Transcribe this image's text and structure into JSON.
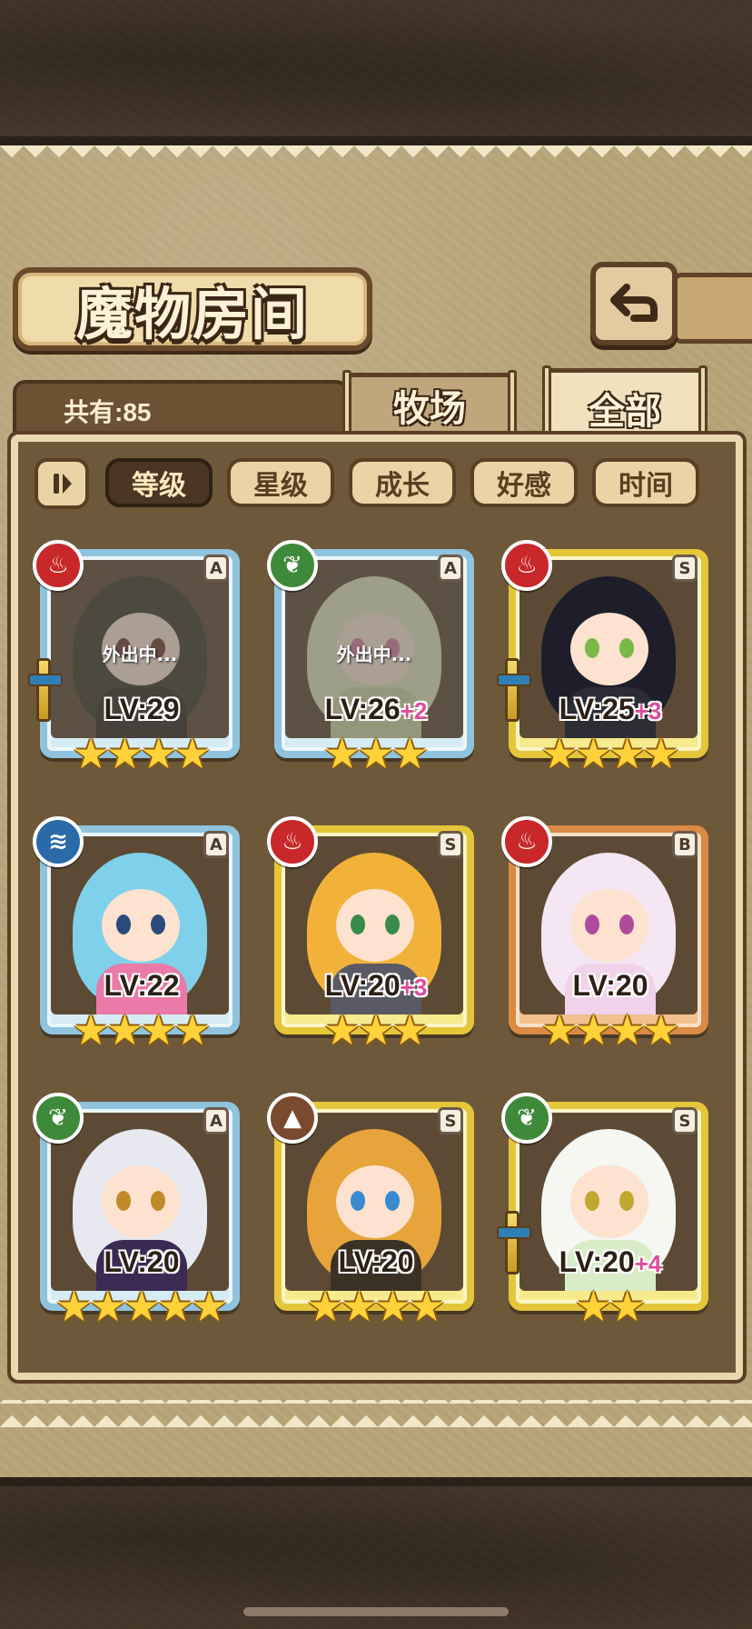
{
  "title": "魔物房间",
  "header": {
    "count_label": "共有:85",
    "tabs": [
      "牧场",
      "全部"
    ],
    "active_tab": "全部"
  },
  "sort": {
    "toggle_icon": "pause-icon",
    "options": [
      "等级",
      "星级",
      "成长",
      "好感",
      "时间"
    ],
    "active": "等级"
  },
  "status": {
    "away": "外出中..."
  },
  "monsters": [
    {
      "lv": "LV:29",
      "plus": "",
      "rank": "A",
      "element": "fire",
      "stars": "★★★★",
      "away": true,
      "equip": true,
      "hair": "#3a3a2a",
      "eyes": "#7a3a2a",
      "body": "#2e2a22"
    },
    {
      "lv": "LV:26",
      "plus": "+2",
      "rank": "A",
      "element": "leaf",
      "stars": "★★★",
      "away": true,
      "equip": false,
      "hair": "#d9e8b8",
      "eyes": "#e07aa6",
      "body": "#c8d89a"
    },
    {
      "lv": "LV:25",
      "plus": "+3",
      "rank": "S",
      "element": "fire",
      "stars": "★★★★",
      "away": false,
      "equip": true,
      "hair": "#1e1e2a",
      "eyes": "#7ab84a",
      "body": "#2c2c34"
    },
    {
      "lv": "LV:22",
      "plus": "",
      "rank": "A",
      "element": "water",
      "stars": "★★★★",
      "away": false,
      "equip": false,
      "hair": "#7fd0ea",
      "eyes": "#2a4a7a",
      "body": "#ea7aa8"
    },
    {
      "lv": "LV:20",
      "plus": "+3",
      "rank": "S",
      "element": "fire",
      "stars": "★★★",
      "away": false,
      "equip": false,
      "hair": "#f2b23a",
      "eyes": "#3a8a4a",
      "body": "#5a5a66"
    },
    {
      "lv": "LV:20",
      "plus": "",
      "rank": "B",
      "element": "fire",
      "stars": "★★★★",
      "away": false,
      "equip": false,
      "hair": "#f4e6f2",
      "eyes": "#b04a9a",
      "body": "#f0d2ea"
    },
    {
      "lv": "LV:20",
      "plus": "",
      "rank": "A",
      "element": "leaf",
      "stars": "★★★★★",
      "away": false,
      "equip": false,
      "hair": "#e8e8f0",
      "eyes": "#c08a2a",
      "body": "#3a2a54"
    },
    {
      "lv": "LV:20",
      "plus": "",
      "rank": "S",
      "element": "earth",
      "stars": "★★★★",
      "away": false,
      "equip": false,
      "hair": "#e6a43a",
      "eyes": "#3a8ad0",
      "body": "#3a3024"
    },
    {
      "lv": "LV:20",
      "plus": "+4",
      "rank": "S",
      "element": "leaf",
      "stars": "★★",
      "away": false,
      "equip": true,
      "hair": "#f6f6f2",
      "eyes": "#c0a830",
      "body": "#d8ecc8"
    }
  ]
}
